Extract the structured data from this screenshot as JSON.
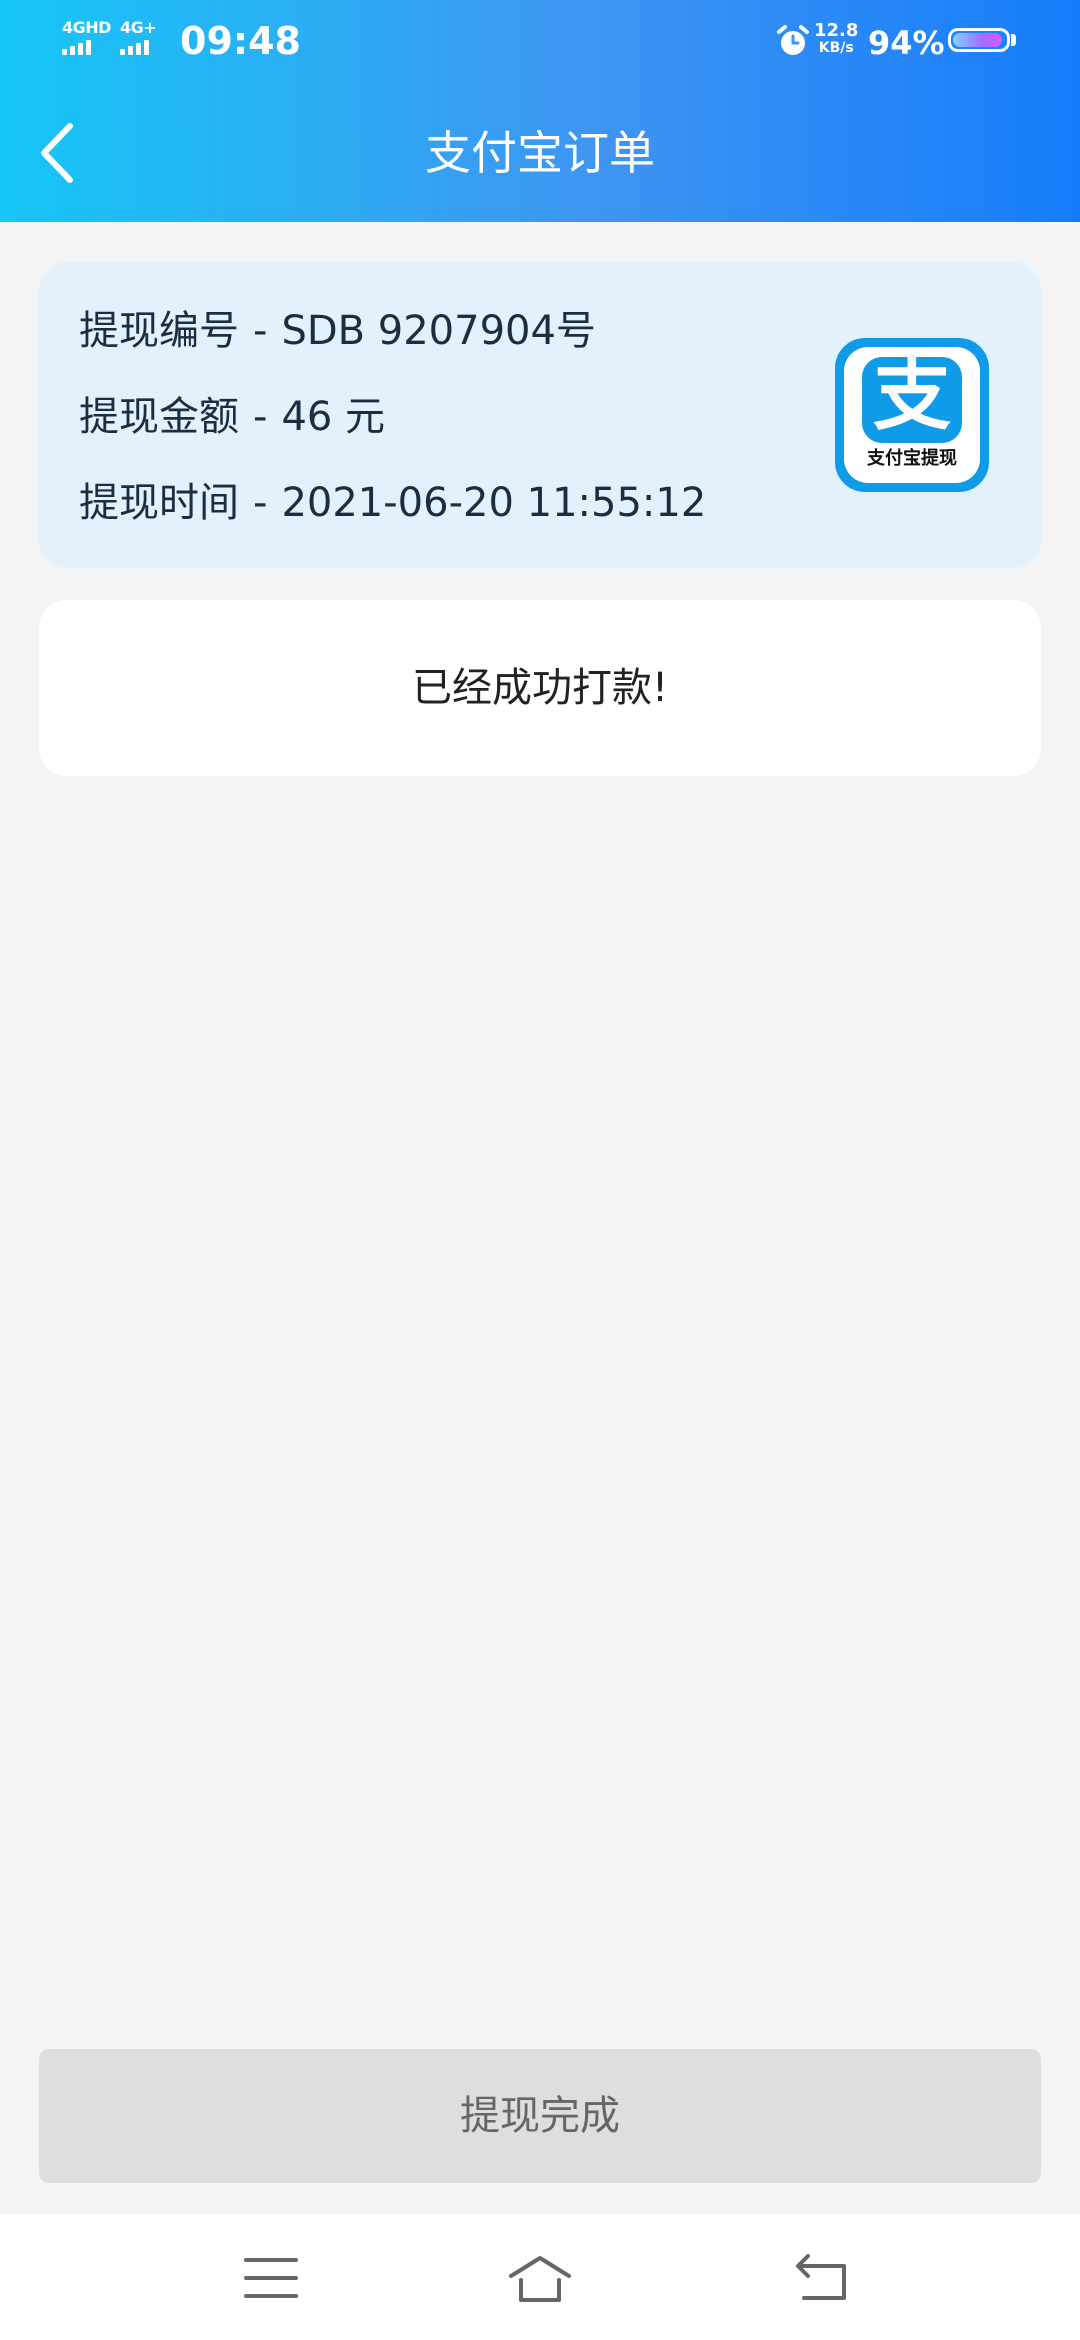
{
  "status_bar": {
    "network_1": "4GHD",
    "network_2": "4G+",
    "time": "09:48",
    "net_speed_value": "12.8",
    "net_speed_unit": "KB/s",
    "battery_percent": "94%",
    "battery_level": 0.94
  },
  "header": {
    "title": "支付宝订单",
    "back_icon": "chevron-left-icon"
  },
  "order": {
    "id_label": "提现编号",
    "id_value": "SDB 9207904号",
    "amount_label": "提现金额",
    "amount_value": "46 元",
    "time_label": "提现时间",
    "time_value": "2021-06-20 11:55:12",
    "separator": "-",
    "logo_char": "支",
    "logo_caption": "支付宝提现"
  },
  "status": {
    "message": "已经成功打款!"
  },
  "action": {
    "done_label": "提现完成"
  },
  "nav_bar": {
    "icons": [
      "menu-icon",
      "home-icon",
      "back-icon"
    ]
  },
  "colors": {
    "header_start": "#16c6f7",
    "header_end": "#157dfb",
    "card_bg": "#e3f1fc",
    "alipay_blue": "#109be8",
    "button_bg": "#dedede"
  }
}
